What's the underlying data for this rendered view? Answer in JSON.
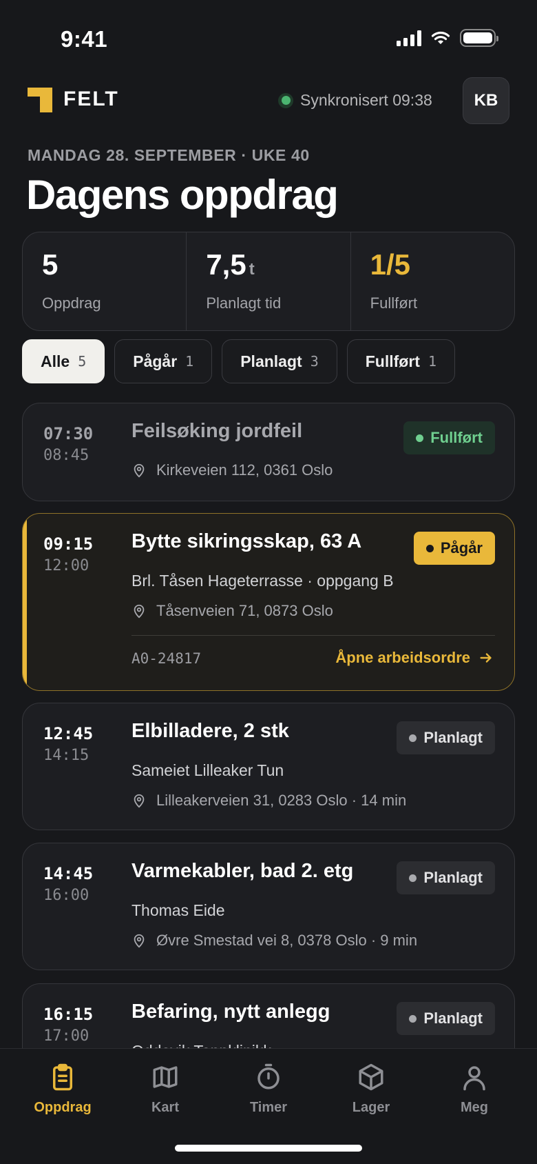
{
  "status_bar": {
    "time": "9:41"
  },
  "header": {
    "brand": "FELT",
    "sync_text": "Synkronisert 09:38",
    "avatar_initials": "KB"
  },
  "date_line": "MANDAG 28. SEPTEMBER · UKE 40",
  "page_title": "Dagens oppdrag",
  "stats": [
    {
      "value": "5",
      "unit": "",
      "label": "Oppdrag"
    },
    {
      "value": "7,5",
      "unit": "t",
      "label": "Planlagt tid"
    },
    {
      "value": "1/5",
      "unit": "",
      "label": "Fullført"
    }
  ],
  "filters": [
    {
      "label": "Alle",
      "count": "5",
      "active": true
    },
    {
      "label": "Pågår",
      "count": "1"
    },
    {
      "label": "Planlagt",
      "count": "3"
    },
    {
      "label": "Fullført",
      "count": "1"
    }
  ],
  "jobs": [
    {
      "start": "07:30",
      "end": "08:45",
      "title": "Feilsøking jordfeil",
      "subtitle": "",
      "address": "Kirkeveien 112, 0361 Oslo",
      "status": "Fullført"
    },
    {
      "start": "09:15",
      "end": "12:00",
      "title": "Bytte sikringsskap, 63 A",
      "subtitle": "Brl. Tåsen Hageterrasse · oppgang B",
      "address": "Tåsenveien 71, 0873 Oslo",
      "status": "Pågår",
      "reference": "A0-24817",
      "action": "Åpne arbeidsordre"
    },
    {
      "start": "12:45",
      "end": "14:15",
      "title": "Elbilladere, 2 stk",
      "subtitle": "Sameiet Lilleaker Tun",
      "address": "Lilleakerveien 31, 0283 Oslo · 14 min",
      "status": "Planlagt"
    },
    {
      "start": "14:45",
      "end": "16:00",
      "title": "Varmekabler, bad 2. etg",
      "subtitle": "Thomas Eide",
      "address": "Øvre Smestad vei 8, 0378 Oslo · 9 min",
      "status": "Planlagt"
    },
    {
      "start": "16:15",
      "end": "17:00",
      "title": "Befaring, nytt anlegg",
      "subtitle": "Oddevik Tannklinikk",
      "address": "",
      "status": "Planlagt"
    }
  ],
  "bottom_nav": [
    {
      "label": "Oppdrag",
      "icon": "clipboard-icon",
      "active": true
    },
    {
      "label": "Kart",
      "icon": "map-icon"
    },
    {
      "label": "Timer",
      "icon": "stopwatch-icon"
    },
    {
      "label": "Lager",
      "icon": "box-icon"
    },
    {
      "label": "Meg",
      "icon": "person-icon"
    }
  ],
  "colors": {
    "accent": "#e9b83a",
    "success": "#6fcf8f",
    "background": "#17181b",
    "card": "#1d1e22"
  }
}
